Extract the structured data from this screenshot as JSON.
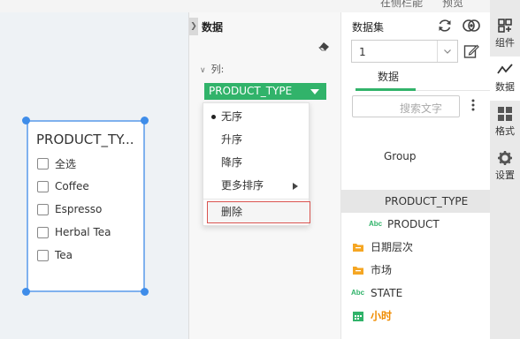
{
  "topbar": {
    "text_left": "在侧栏能",
    "text_right": "预览"
  },
  "canvas": {
    "filter_card": {
      "title": "PRODUCT_TY...",
      "options": [
        "全选",
        "Coffee",
        "Espresso",
        "Herbal Tea",
        "Tea"
      ]
    }
  },
  "data_panel": {
    "title": "数据",
    "columns_label": "列:",
    "field_pill": "PRODUCT_TYPE"
  },
  "sort_menu": {
    "items": [
      "无序",
      "升序",
      "降序",
      "更多排序"
    ],
    "selected": "无序",
    "delete": "删除"
  },
  "dataset_panel": {
    "title": "数据集",
    "dataset_value": "1",
    "tab": "数据",
    "search_placeholder": "搜索文字",
    "tree": [
      "Group",
      "PRODUCT_TYPE",
      "PRODUCT",
      "日期层次",
      "市场",
      "STATE",
      "小时"
    ],
    "abc_badge": "Abc"
  },
  "sidebar": {
    "items": [
      "组件",
      "数据",
      "格式",
      "设置"
    ]
  },
  "colors": {
    "accent_green": "#31b36a",
    "selection_blue": "#3f8de9",
    "delete_border": "#d9534f",
    "folder_orange": "#f5a623"
  }
}
